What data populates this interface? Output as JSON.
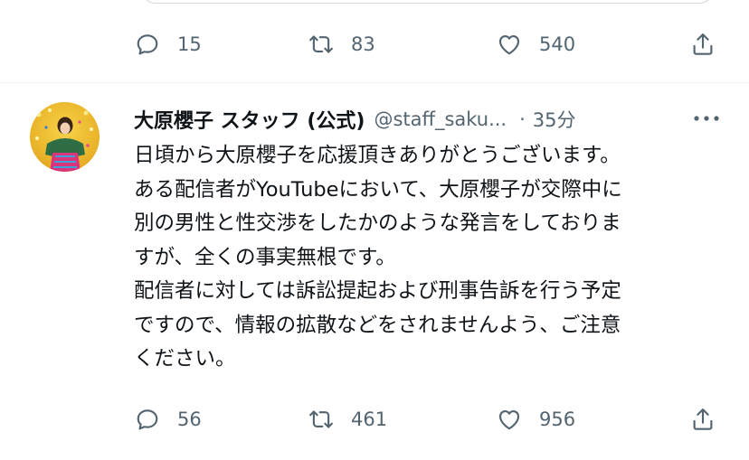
{
  "previous_tweet": {
    "actions": {
      "reply_count": "15",
      "retweet_count": "83",
      "like_count": "540"
    }
  },
  "tweet": {
    "author": {
      "name": "大原櫻子 スタッフ (公式)",
      "handle": "@staff_saku...",
      "separator": "·",
      "time": "35分"
    },
    "lines": [
      "日頃から大原櫻子を応援頂きありがとうございます。",
      "ある配信者がYouTubeにおいて、大原櫻子が交際中に",
      "別の男性と性交渉をしたかのような発言をしておりま",
      "すが、全くの事実無根です。",
      "配信者に対しては訴訟提起および刑事告訴を行う予定",
      "ですので、情報の拡散などをされませんよう、ご注意",
      "ください。"
    ],
    "actions": {
      "reply_count": "56",
      "retweet_count": "461",
      "like_count": "956"
    }
  },
  "colors": {
    "text": "#0f1419",
    "secondary": "#536471",
    "divider": "#eff3f4"
  },
  "icons": [
    "reply-icon",
    "retweet-icon",
    "like-icon",
    "share-icon",
    "more-icon"
  ]
}
